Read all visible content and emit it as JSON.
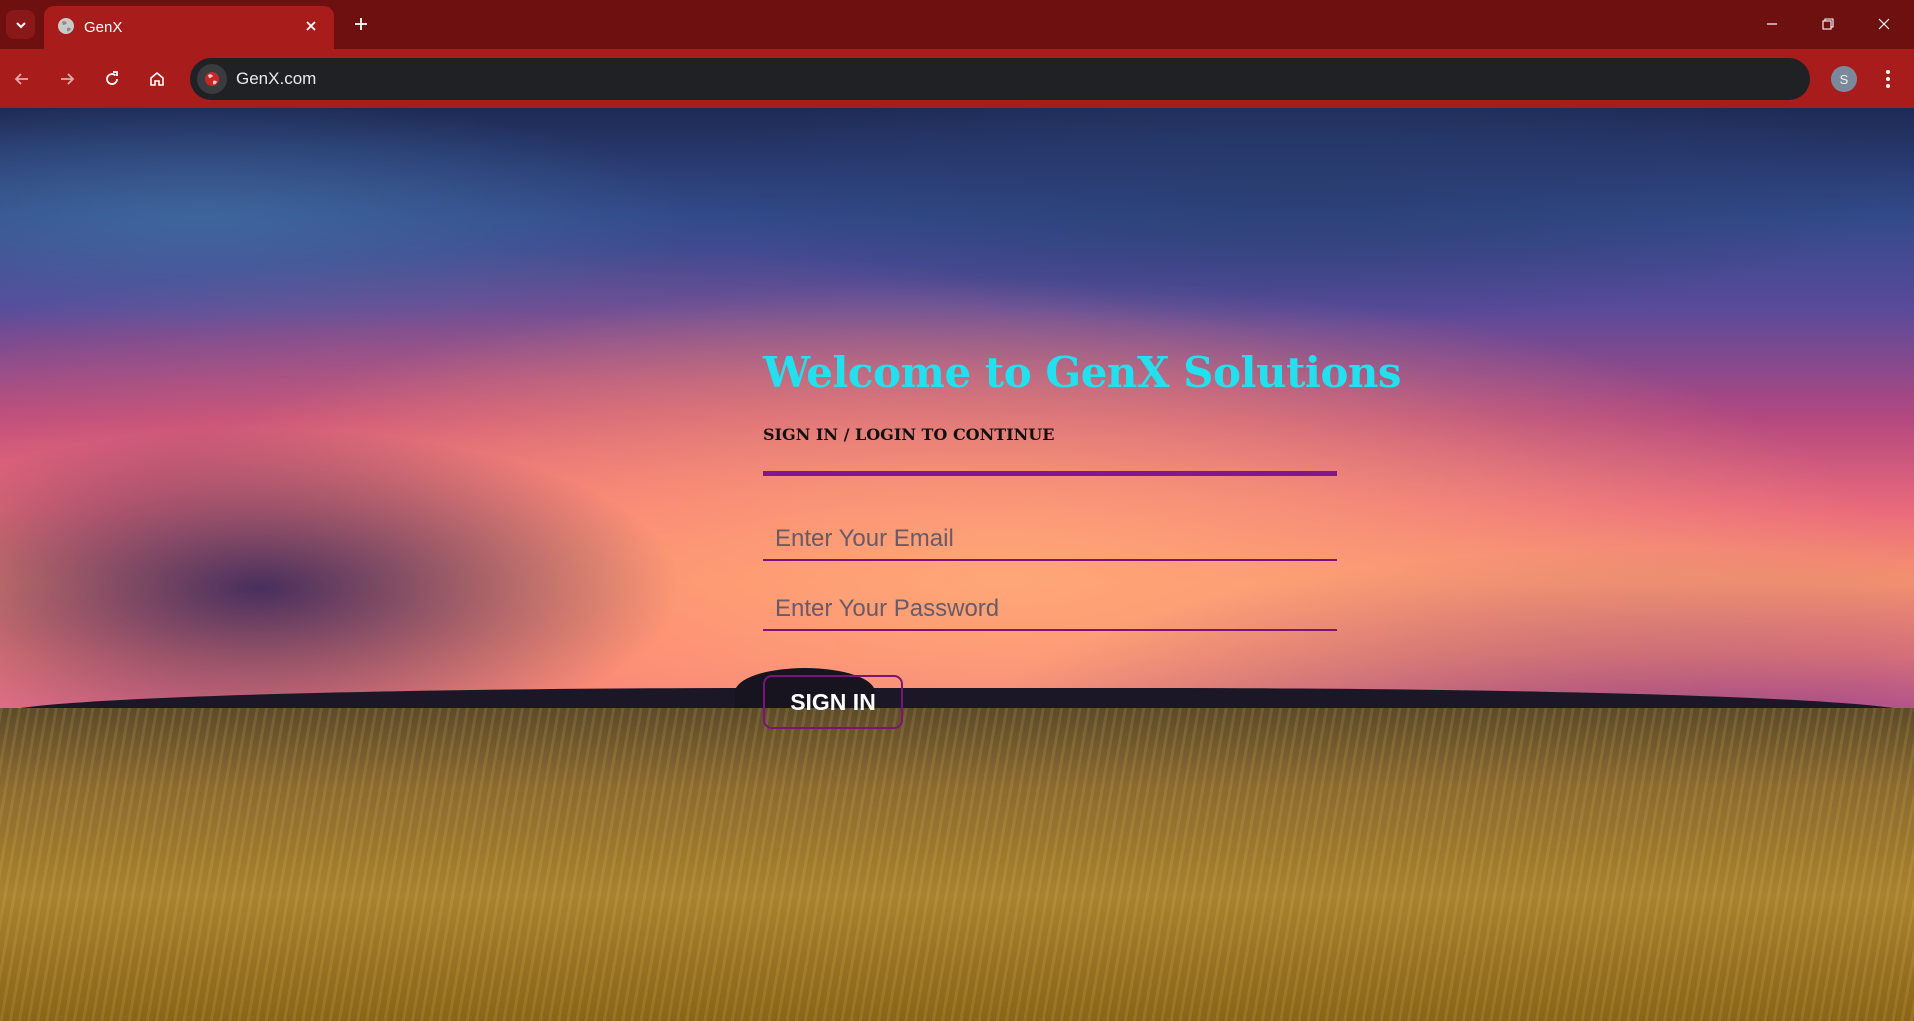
{
  "browser": {
    "tab_title": "GenX",
    "url": "GenX.com",
    "profile_initial": "S",
    "colors": {
      "tab_strip": "#6e1010",
      "toolbar": "#a81c1c",
      "omnibox": "#202124"
    }
  },
  "page": {
    "title": "Welcome to GenX Solutions",
    "subtitle": "SIGN IN / LOGIN TO CONTINUE",
    "email_placeholder": "Enter Your Email",
    "password_placeholder": "Enter Your Password",
    "signin_label": "SIGN IN",
    "colors": {
      "title": "#22e0ee",
      "accent": "#82168a"
    }
  }
}
